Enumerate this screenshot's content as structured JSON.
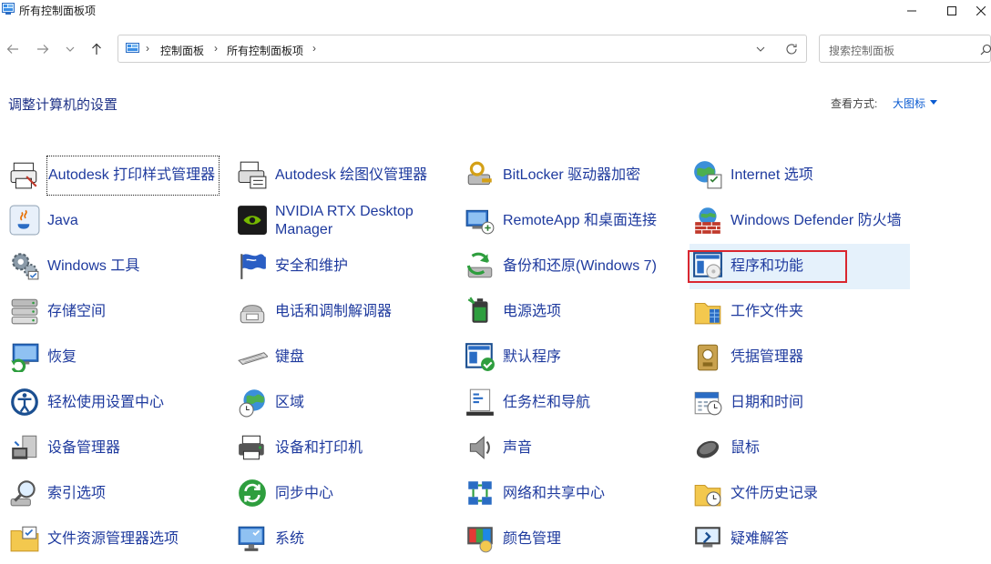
{
  "window": {
    "title": "所有控制面板项"
  },
  "address": {
    "crumbs": [
      "控制面板",
      "所有控制面板项"
    ]
  },
  "search": {
    "placeholder": "搜索控制面板"
  },
  "header": {
    "title": "调整计算机的设置",
    "view_by_label": "查看方式:",
    "view_by_value": "大图标"
  },
  "colors": {
    "link": "#1e3a9e",
    "heading": "#1e3287",
    "hover": "#e5f1fb",
    "highlight": "#d9262f"
  },
  "items": [
    {
      "label": "Autodesk 打印样式管理器",
      "icon": "printer-style-icon"
    },
    {
      "label": "Autodesk 绘图仪管理器",
      "icon": "plotter-icon"
    },
    {
      "label": "BitLocker 驱动器加密",
      "icon": "bitlocker-icon"
    },
    {
      "label": "Internet 选项",
      "icon": "internet-options-icon"
    },
    {
      "label": "Java",
      "icon": "java-icon"
    },
    {
      "label": "NVIDIA RTX Desktop Manager",
      "icon": "nvidia-icon"
    },
    {
      "label": "RemoteApp 和桌面连接",
      "icon": "remoteapp-icon"
    },
    {
      "label": "Windows Defender 防火墙",
      "icon": "firewall-icon"
    },
    {
      "label": "Windows 工具",
      "icon": "windows-tools-icon"
    },
    {
      "label": "安全和维护",
      "icon": "security-flag-icon"
    },
    {
      "label": "备份和还原(Windows 7)",
      "icon": "backup-icon"
    },
    {
      "label": "程序和功能",
      "icon": "programs-icon"
    },
    {
      "label": "存储空间",
      "icon": "storage-icon"
    },
    {
      "label": "电话和调制解调器",
      "icon": "phone-modem-icon"
    },
    {
      "label": "电源选项",
      "icon": "power-icon"
    },
    {
      "label": "工作文件夹",
      "icon": "work-folders-icon"
    },
    {
      "label": "恢复",
      "icon": "recovery-icon"
    },
    {
      "label": "键盘",
      "icon": "keyboard-icon"
    },
    {
      "label": "默认程序",
      "icon": "default-programs-icon"
    },
    {
      "label": "凭据管理器",
      "icon": "credential-icon"
    },
    {
      "label": "轻松使用设置中心",
      "icon": "ease-of-access-icon"
    },
    {
      "label": "区域",
      "icon": "region-icon"
    },
    {
      "label": "任务栏和导航",
      "icon": "taskbar-icon"
    },
    {
      "label": "日期和时间",
      "icon": "datetime-icon"
    },
    {
      "label": "设备管理器",
      "icon": "device-manager-icon"
    },
    {
      "label": "设备和打印机",
      "icon": "devices-printers-icon"
    },
    {
      "label": "声音",
      "icon": "sound-icon"
    },
    {
      "label": "鼠标",
      "icon": "mouse-icon"
    },
    {
      "label": "索引选项",
      "icon": "indexing-icon"
    },
    {
      "label": "同步中心",
      "icon": "sync-icon"
    },
    {
      "label": "网络和共享中心",
      "icon": "network-icon"
    },
    {
      "label": "文件历史记录",
      "icon": "file-history-icon"
    },
    {
      "label": "文件资源管理器选项",
      "icon": "explorer-options-icon"
    },
    {
      "label": "系统",
      "icon": "system-icon"
    },
    {
      "label": "颜色管理",
      "icon": "color-management-icon"
    },
    {
      "label": "疑难解答",
      "icon": "troubleshoot-icon"
    }
  ]
}
